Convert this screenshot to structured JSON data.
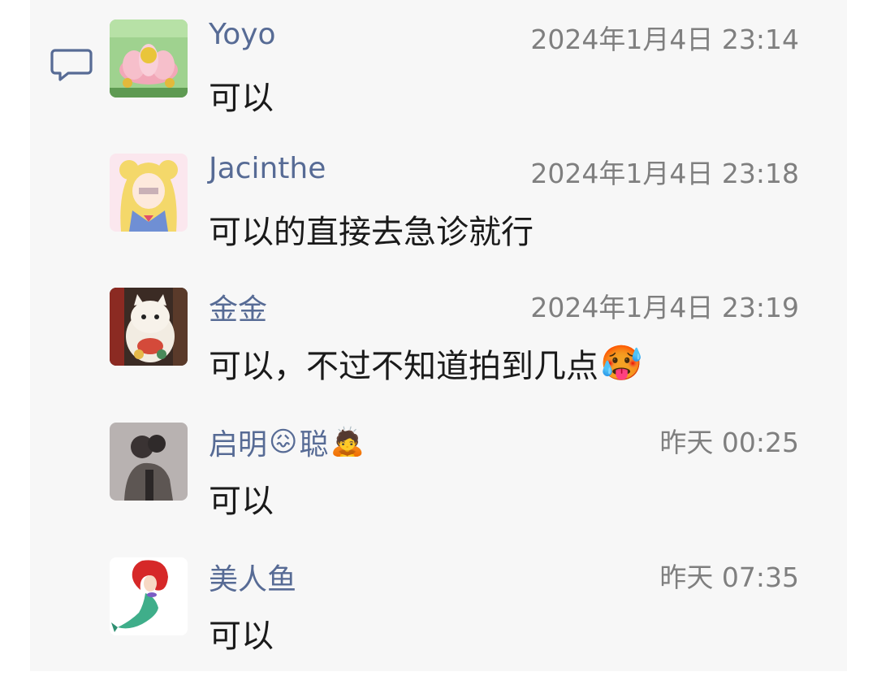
{
  "messages": [
    {
      "avatar": "avatar-lotus-frog",
      "name": "Yoyo",
      "name_emojis": [],
      "time": "2024年1月4日 23:14",
      "text": "可以",
      "text_emoji": ""
    },
    {
      "avatar": "avatar-sailor-girl",
      "name": "Jacinthe",
      "name_emojis": [],
      "time": "2024年1月4日 23:18",
      "text": "可以的直接去急诊就行",
      "text_emoji": ""
    },
    {
      "avatar": "avatar-lucky-cat",
      "name": "金金",
      "name_emojis": [],
      "time": "2024年1月4日 23:19",
      "text": "可以，不过不知道拍到几点",
      "text_emoji": "🥵"
    },
    {
      "avatar": "avatar-person-photo",
      "name": "启明",
      "name_emoji_1": "😖",
      "name_2": "聪",
      "name_emoji_2": "🙇",
      "time": "昨天 00:25",
      "text": "可以",
      "text_emoji": ""
    },
    {
      "avatar": "avatar-mermaid",
      "name": "美人鱼",
      "name_emojis": [],
      "time": "昨天 07:35",
      "text": "可以",
      "text_emoji": ""
    }
  ],
  "icons": {
    "comment": "comment-bubble-icon"
  },
  "colors": {
    "name": "#576b95",
    "time": "#7f7f7f",
    "text": "#1a1a1a",
    "panel": "#f7f7f7"
  }
}
